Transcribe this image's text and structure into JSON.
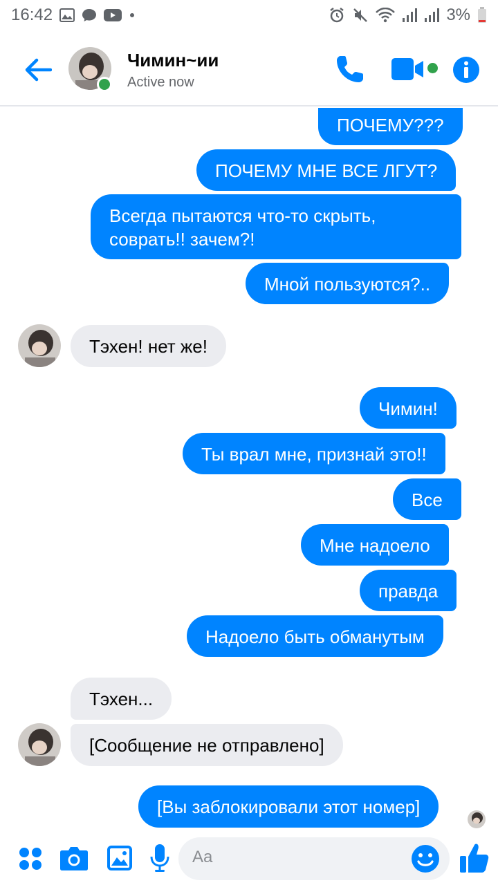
{
  "status_bar": {
    "time": "16:42",
    "battery": "3%"
  },
  "header": {
    "contact_name": "Чимин~ии",
    "status": "Active now",
    "accent_color": "#0084ff",
    "online_color": "#31a24c"
  },
  "messages": [
    {
      "side": "out",
      "text": "ПОЧЕМУ???"
    },
    {
      "side": "out",
      "text": "ПОЧЕМУ МНЕ ВСЕ ЛГУТ?"
    },
    {
      "side": "out",
      "text": "Всегда пытаются что-то скрыть,\nсоврать!! зачем?!"
    },
    {
      "side": "out",
      "text": "Мной пользуются?.."
    },
    {
      "side": "in",
      "text": "Тэхен! нет же!"
    },
    {
      "side": "out",
      "text": "Чимин!"
    },
    {
      "side": "out",
      "text": "Ты врал мне, признай это!!"
    },
    {
      "side": "out",
      "text": "Все"
    },
    {
      "side": "out",
      "text": "Мне надоело"
    },
    {
      "side": "out",
      "text": "правда"
    },
    {
      "side": "out",
      "text": "Надоело быть обманутым"
    },
    {
      "side": "in",
      "text": "Тэхен..."
    },
    {
      "side": "in",
      "text": "[Сообщение не отправлено]"
    },
    {
      "side": "out",
      "text": "[Вы заблокировали этот номер]"
    }
  ],
  "composer": {
    "placeholder": "Aa"
  },
  "icons": [
    "back-arrow-icon",
    "phone-icon",
    "video-icon",
    "info-icon",
    "menu-dots-icon",
    "camera-icon",
    "gallery-icon",
    "microphone-icon",
    "emoji-icon",
    "thumbs-up-icon"
  ]
}
